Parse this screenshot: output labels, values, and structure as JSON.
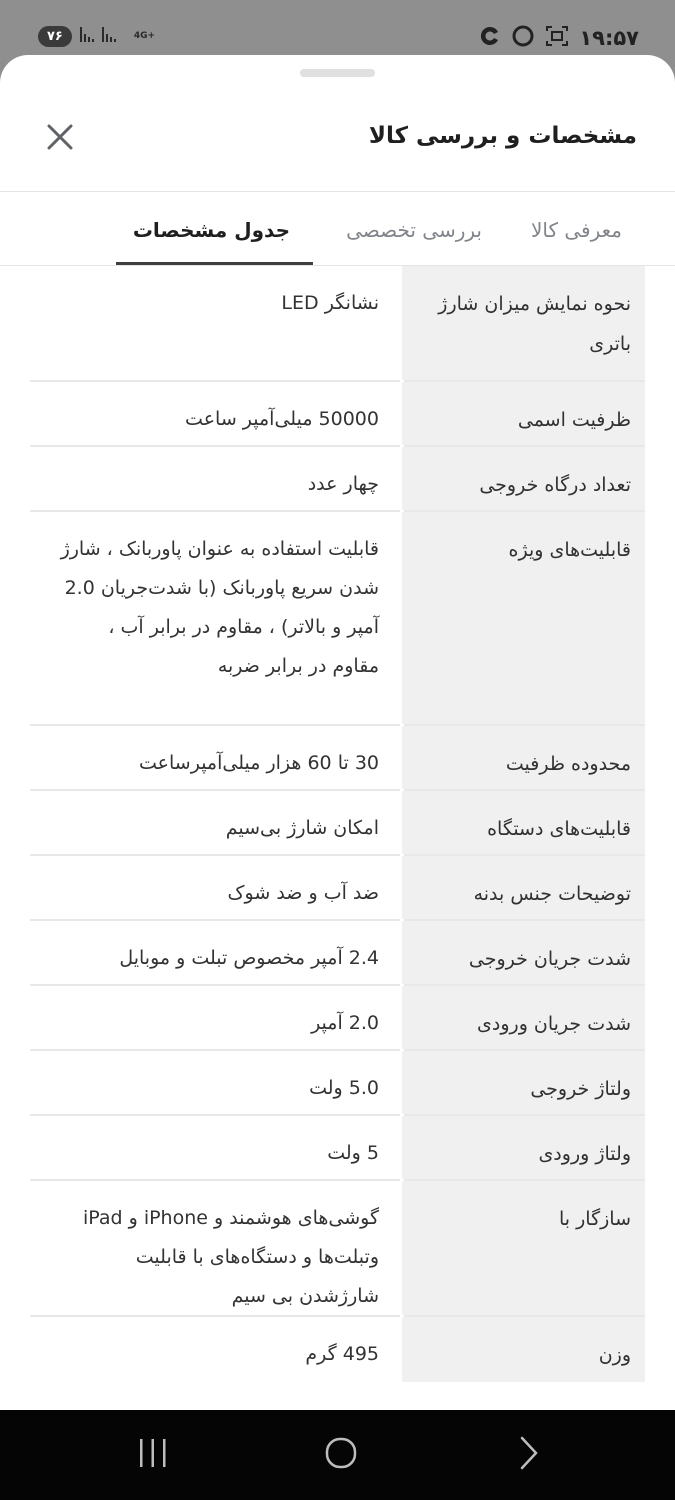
{
  "status_bar": {
    "battery": "۷۶",
    "network": "4G+",
    "time": "۱۹:۵۷"
  },
  "sheet": {
    "title": "مشخصات و بررسی کالا",
    "close_icon": "close-icon"
  },
  "tabs": [
    {
      "label": "معرفی کالا",
      "active": false
    },
    {
      "label": "بررسی تخصصی",
      "active": false
    },
    {
      "label": "جدول مشخصات",
      "active": true
    }
  ],
  "specs": [
    {
      "label": "نحوه نمایش میزان شارژ باتری",
      "value": "نشانگر LED"
    },
    {
      "label": "ظرفیت اسمی",
      "value": "50000 میلی‌آمپر ساعت"
    },
    {
      "label": "تعداد درگاه خروجی",
      "value": "چهار عدد"
    },
    {
      "label": "قابلیت‌های ویژه",
      "value": "قابلیت استفاده به عنوان پاوربانک ، شارژ شدن سریع پاوربانک (با شدت‌جریان 2.0 آمپر و بالاتر) ، مقاوم در برابر آب ، مقاوم در برابر ضربه"
    },
    {
      "label": "محدوده ظرفیت",
      "value": "30 تا 60 هزار میلی‌آمپرساعت"
    },
    {
      "label": "قابلیت‌های دستگاه",
      "value": "امکان شارژ بی‌سیم"
    },
    {
      "label": "توضیحات جنس بدنه",
      "value": "ضد آب و ضد شوک"
    },
    {
      "label": "شدت جریان خروجی",
      "value": "2.4 آمپر مخصوص تبلت و موبایل"
    },
    {
      "label": "شدت جریان ورودی",
      "value": "2.0 آمپر"
    },
    {
      "label": "ولتاژ خروجی",
      "value": "5.0 ولت"
    },
    {
      "label": "ولتاژ ورودی",
      "value": "5 ولت"
    },
    {
      "label": "سازگار با",
      "value": "گوشی‌های هوشمند و iPhone و iPad وتبلت‌ها و دستگاه‌های با قابلیت شارژشدن بی سیم"
    },
    {
      "label": "وزن",
      "value": "495 گرم"
    }
  ],
  "nav_bar": {
    "recents_icon": "recents-icon",
    "home_icon": "home-icon",
    "back_icon": "back-icon"
  }
}
